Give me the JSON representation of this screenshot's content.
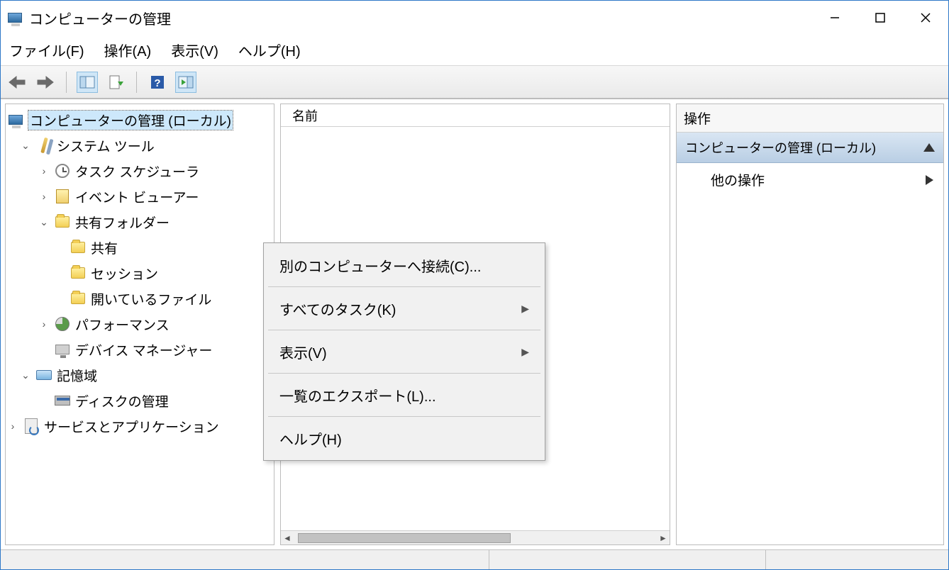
{
  "window": {
    "title": "コンピューターの管理"
  },
  "menubar": {
    "file": "ファイル(F)",
    "action": "操作(A)",
    "view": "表示(V)",
    "help": "ヘルプ(H)"
  },
  "tree": {
    "root": "コンピューターの管理 (ローカル)",
    "system_tools": "システム ツール",
    "task_scheduler": "タスク スケジューラ",
    "event_viewer": "イベント ビューアー",
    "shared_folders": "共有フォルダー",
    "shares": "共有",
    "sessions": "セッション",
    "open_files": "開いているファイル",
    "performance": "パフォーマンス",
    "device_manager": "デバイス マネージャー",
    "storage": "記憶域",
    "disk_mgmt": "ディスクの管理",
    "services_apps": "サービスとアプリケーション"
  },
  "list": {
    "col_name": "名前"
  },
  "actions": {
    "title": "操作",
    "group": "コンピューターの管理 (ローカル)",
    "more": "他の操作"
  },
  "context_menu": {
    "connect": "別のコンピューターへ接続(C)...",
    "all_tasks": "すべてのタスク(K)",
    "view": "表示(V)",
    "export_list": "一覧のエクスポート(L)...",
    "help": "ヘルプ(H)"
  }
}
